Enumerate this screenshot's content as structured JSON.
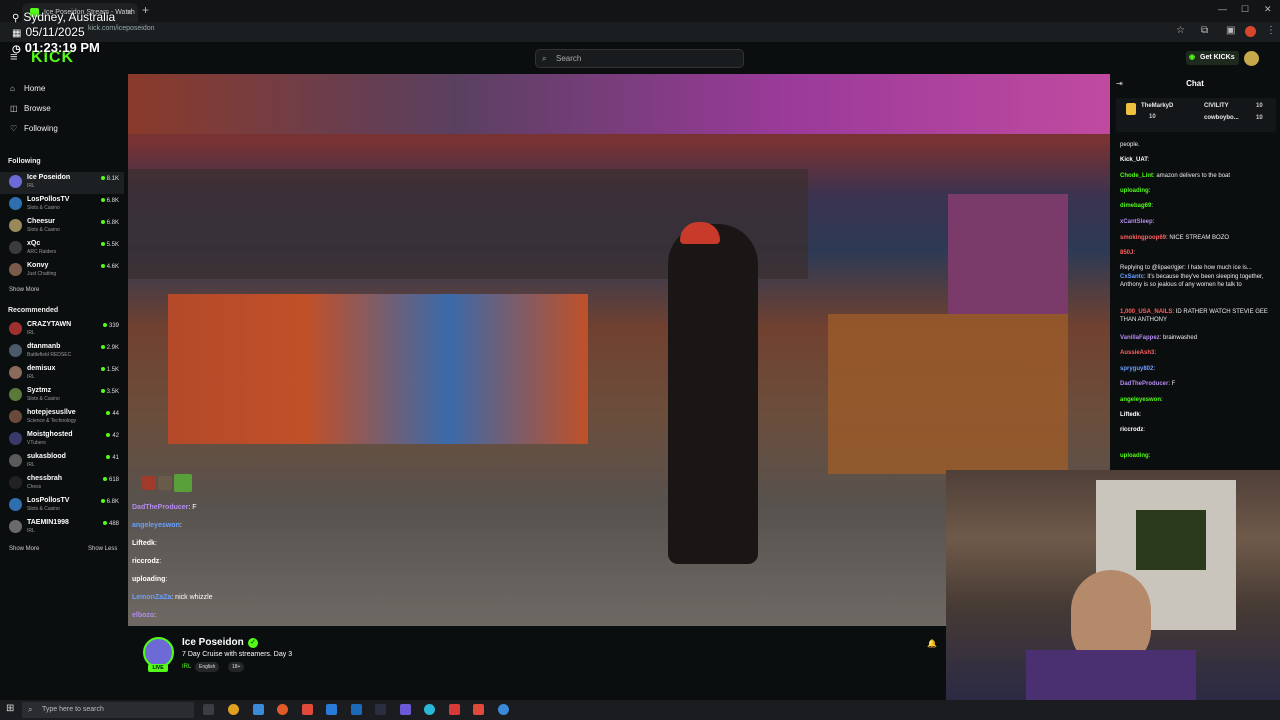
{
  "overlay": {
    "location": "Sydney, Australia",
    "date": "05/11/2025",
    "time": "01:23:19 PM"
  },
  "browser": {
    "tab_title": "Ice Poseidon Stream - Watch",
    "url": "kick.com/iceposeidon"
  },
  "header": {
    "logo": "KICK",
    "search_placeholder": "Search",
    "get_kicks": "Get KICKs"
  },
  "sidebar": {
    "nav": [
      {
        "label": "Home",
        "icon": "home-icon"
      },
      {
        "label": "Browse",
        "icon": "browse-icon"
      },
      {
        "label": "Following",
        "icon": "heart-icon"
      }
    ],
    "following_title": "Following",
    "following": [
      {
        "name": "Ice Poseidon",
        "category": "IRL",
        "viewers": "8.1K",
        "color": "#6d6ad8"
      },
      {
        "name": "LosPollosTV",
        "category": "Slots & Casino",
        "viewers": "6.8K",
        "color": "#2f6fb0"
      },
      {
        "name": "Cheesur",
        "category": "Slots & Casino",
        "viewers": "6.8K",
        "color": "#9a8a5a"
      },
      {
        "name": "xQc",
        "category": "ARC Raiders",
        "viewers": "5.5K",
        "color": "#3b3b3b"
      },
      {
        "name": "Konvy",
        "category": "Just Chatting",
        "viewers": "4.6K",
        "color": "#7a5a4a"
      }
    ],
    "show_more": "Show More",
    "recommended_title": "Recommended",
    "recommended": [
      {
        "name": "CRAZYTAWN",
        "category": "IRL",
        "viewers": "339",
        "color": "#a03030"
      },
      {
        "name": "dtanmanb",
        "category": "Battlefield REDSEC",
        "viewers": "2.9K",
        "color": "#4a5a6a"
      },
      {
        "name": "demisux",
        "category": "IRL",
        "viewers": "1.5K",
        "color": "#8a6a5a"
      },
      {
        "name": "Syztmz",
        "category": "Slots & Casino",
        "viewers": "3.5K",
        "color": "#5a7a3a"
      },
      {
        "name": "hotepjesusllve",
        "category": "Science & Technology",
        "viewers": "44",
        "color": "#6a4a3a"
      },
      {
        "name": "Moistghosted",
        "category": "VTubers",
        "viewers": "42",
        "color": "#3a3a6a"
      },
      {
        "name": "sukasblood",
        "category": "IRL",
        "viewers": "41",
        "color": "#5a5a5a"
      },
      {
        "name": "chessbrah",
        "category": "Chess",
        "viewers": "618",
        "color": "#222222"
      },
      {
        "name": "LosPollosTV",
        "category": "Slots & Casino",
        "viewers": "6.8K",
        "color": "#2f6fb0"
      },
      {
        "name": "TAEMIN1998",
        "category": "IRL",
        "viewers": "488",
        "color": "#6a6a6a"
      }
    ],
    "show_more2": "Show More",
    "show_less": "Show Less"
  },
  "video_chat": [
    {
      "user": "DadTheProducer",
      "text": ": F",
      "color": "#b58af0"
    },
    {
      "user": "angeleyeswon",
      "text": ":",
      "color": "#6aa0ff"
    },
    {
      "user": "Liftedk",
      "text": ":",
      "color": "#ffffff"
    },
    {
      "user": "riccrodz",
      "text": ":",
      "color": "#ffffff"
    },
    {
      "user": "uploading",
      "text": ":",
      "color": "#ffffff"
    },
    {
      "user": "LemonZaZa",
      "text": ": nick whizzle",
      "color": "#6aa0ff"
    },
    {
      "user": "elbozo",
      "text": ":",
      "color": "#b58af0"
    }
  ],
  "stream": {
    "name": "Ice Poseidon",
    "title": "7 Day Cruise with streamers. Day 3",
    "category": "IRL",
    "tags": [
      "English",
      "18+"
    ],
    "live": "LIVE"
  },
  "chat": {
    "title": "Chat",
    "pinned": [
      {
        "name": "TheMarkyD",
        "sub": "10",
        "color": "#f0c040"
      },
      {
        "name": "CIVILITY",
        "sub": "10",
        "color": "#cccccc"
      },
      {
        "name": "cowboybo...",
        "sub": "10",
        "color": "#f0c040"
      }
    ],
    "messages": [
      {
        "user": "",
        "text": "people.",
        "color": "#ffffff"
      },
      {
        "user": "Kick_UAT",
        "text": ":",
        "color": "#ffffff"
      },
      {
        "user": "Chode_Lint",
        "text": ": amazon delivers to the boat",
        "color": "#53fc18"
      },
      {
        "user": "uploading",
        "text": ":",
        "color": "#53fc18"
      },
      {
        "user": "dimebag69",
        "text": ":",
        "color": "#53fc18"
      },
      {
        "user": "xCantSleep",
        "text": ":",
        "color": "#b58af0"
      },
      {
        "user": "smokingpoop69",
        "text": ": NICE STREAM BOZO",
        "color": "#ff6060"
      },
      {
        "user": "850J",
        "text": ":",
        "color": "#ff6060"
      },
      {
        "user": "",
        "text": "Replying to @lipaer/gjer: I hate how much ice is...",
        "color": "#888888"
      },
      {
        "user": "CxSantc",
        "text": ": it's because they've been sleeping together, Anthony is so jealous of any women he talk to",
        "color": "#6aa0ff"
      },
      {
        "user": "1,000_USA_NAILS",
        "text": ": ID RATHER WATCH STEVIE GEE THAN ANTHONY",
        "color": "#ff6060"
      },
      {
        "user": "VanillaFappez",
        "text": ": brainwashed",
        "color": "#b58af0"
      },
      {
        "user": "AussieAsh3",
        "text": ":",
        "color": "#ff6060"
      },
      {
        "user": "spryguy802",
        "text": ":",
        "color": "#6aa0ff"
      },
      {
        "user": "DadTheProducer",
        "text": ": F",
        "color": "#b58af0"
      },
      {
        "user": "angeleyeswon",
        "text": ":",
        "color": "#53fc18"
      },
      {
        "user": "Liftedk",
        "text": ":",
        "color": "#ffffff"
      },
      {
        "user": "riccrodz",
        "text": ":",
        "color": "#ffffff"
      },
      {
        "user": "uploading",
        "text": ":",
        "color": "#53fc18"
      }
    ]
  },
  "taskbar": {
    "search_placeholder": "Type here to search"
  },
  "colors": {
    "accent": "#53fc18",
    "background": "#0b0e0f"
  }
}
